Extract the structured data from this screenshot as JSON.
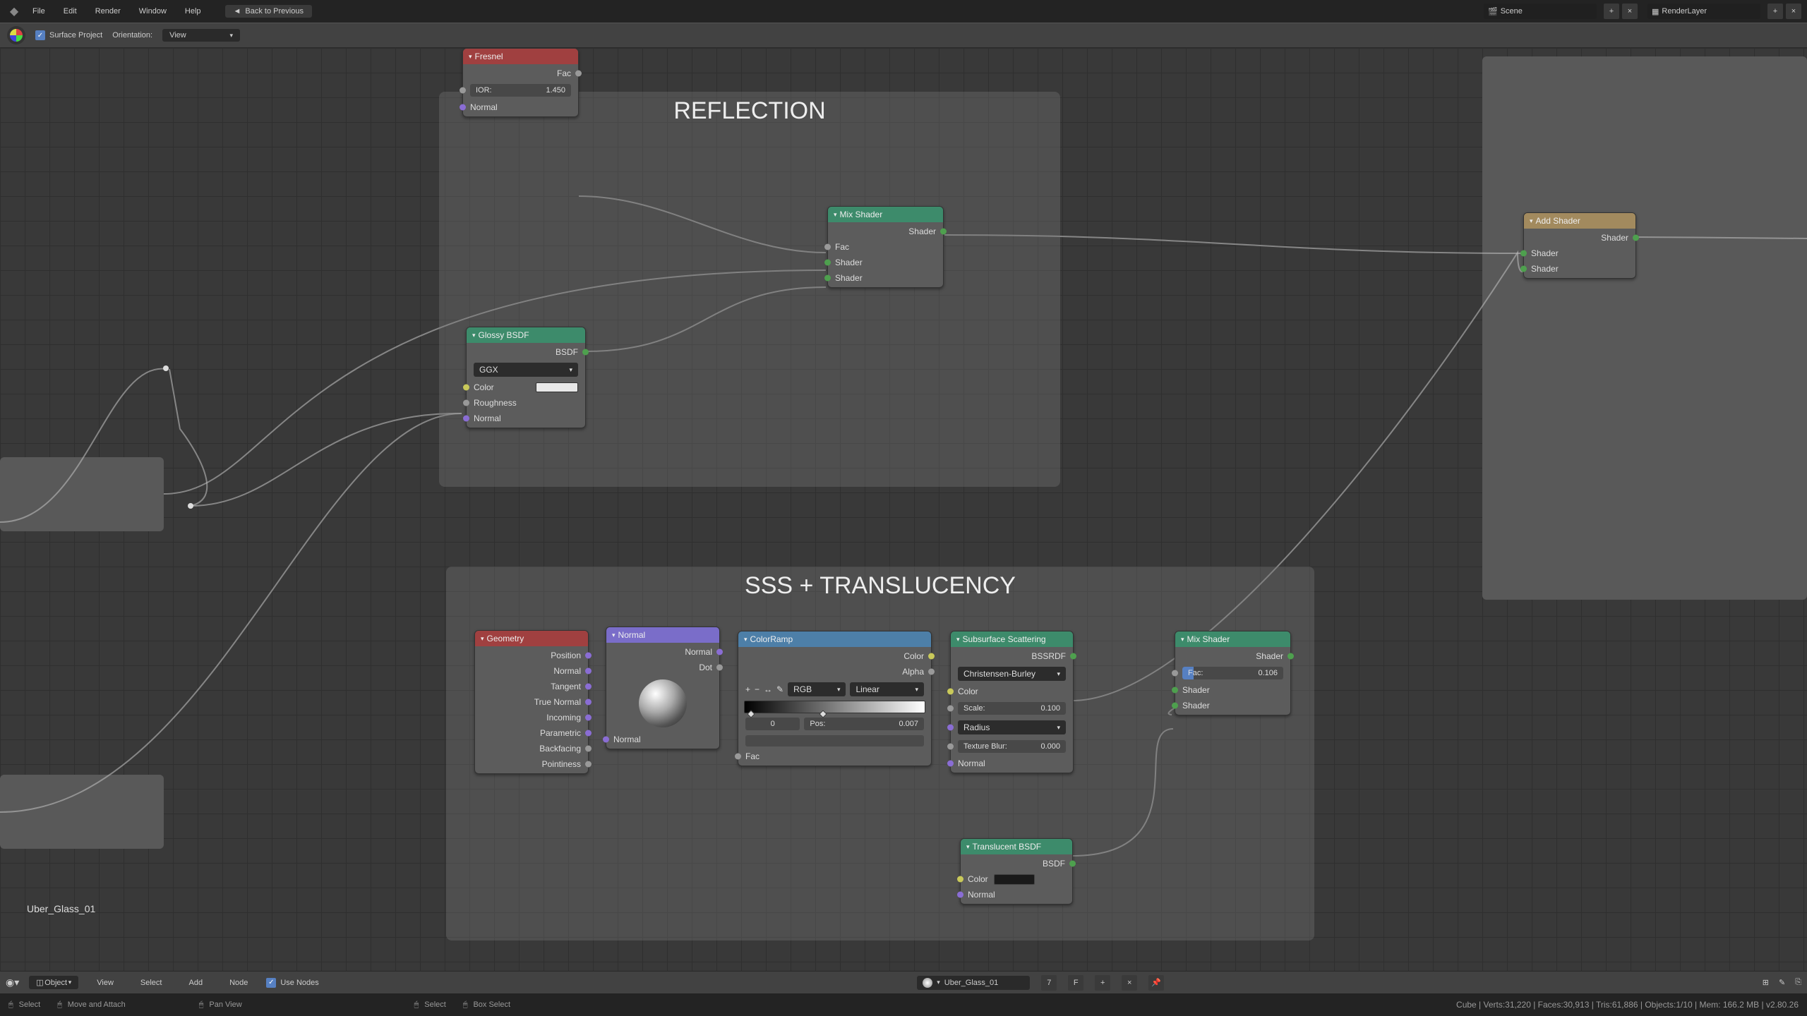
{
  "topmenu": {
    "file": "File",
    "edit": "Edit",
    "render": "Render",
    "window": "Window",
    "help": "Help",
    "back": "Back to Previous",
    "scene_name": "Scene",
    "renderlayer": "RenderLayer"
  },
  "secondbar": {
    "surface_project": "Surface Project",
    "orientation": "Orientation:",
    "orientation_value": "View"
  },
  "frames": {
    "reflection": "REFLECTION",
    "sss": "SSS + TRANSLUCENCY"
  },
  "nodes": {
    "fresnel": {
      "title": "Fresnel",
      "fac": "Fac",
      "ior_label": "IOR:",
      "ior_val": "1.450",
      "normal": "Normal"
    },
    "glossy": {
      "title": "Glossy BSDF",
      "bsdf": "BSDF",
      "dist": "GGX",
      "color": "Color",
      "roughness": "Roughness",
      "normal": "Normal"
    },
    "mix1": {
      "title": "Mix Shader",
      "shader_out": "Shader",
      "fac": "Fac",
      "shader1": "Shader",
      "shader2": "Shader"
    },
    "add": {
      "title": "Add Shader",
      "shader_out": "Shader",
      "shader1": "Shader",
      "shader2": "Shader"
    },
    "geometry": {
      "title": "Geometry",
      "position": "Position",
      "normal": "Normal",
      "tangent": "Tangent",
      "true_normal": "True Normal",
      "incoming": "Incoming",
      "parametric": "Parametric",
      "backfacing": "Backfacing",
      "pointiness": "Pointiness"
    },
    "normal": {
      "title": "Normal",
      "normal_out": "Normal",
      "dot": "Dot",
      "normal_in": "Normal"
    },
    "colorramp": {
      "title": "ColorRamp",
      "color": "Color",
      "alpha": "Alpha",
      "mode": "RGB",
      "interp": "Linear",
      "pos_label": "Pos:",
      "pos_val": "0.007",
      "index": "0",
      "fac": "Fac"
    },
    "sss": {
      "title": "Subsurface Scattering",
      "bssrdf": "BSSRDF",
      "falloff": "Christensen-Burley",
      "color": "Color",
      "scale_label": "Scale:",
      "scale_val": "0.100",
      "radius": "Radius",
      "tb_label": "Texture Blur:",
      "tb_val": "0.000",
      "normal": "Normal"
    },
    "translucent": {
      "title": "Translucent BSDF",
      "bsdf": "BSDF",
      "color": "Color",
      "normal": "Normal"
    },
    "mix2": {
      "title": "Mix Shader",
      "shader_out": "Shader",
      "fac_label": "Fac:",
      "fac_val": "0.106",
      "shader1": "Shader",
      "shader2": "Shader"
    }
  },
  "material_display": "Uber_Glass_01",
  "node_footer": {
    "object_mode": "Object",
    "view": "View",
    "select": "Select",
    "add": "Add",
    "node": "Node",
    "use_nodes": "Use Nodes",
    "material_name": "Uber_Glass_01",
    "users": "7",
    "fake": "F"
  },
  "status_footer": {
    "select": "Select",
    "move_attach": "Move and Attach",
    "pan": "Pan View",
    "select2": "Select",
    "box_select": "Box Select",
    "stats": "Cube | Verts:31,220 | Faces:30,913 | Tris:61,886 | Objects:1/10 | Mem: 166.2 MB | v2.80.26"
  }
}
